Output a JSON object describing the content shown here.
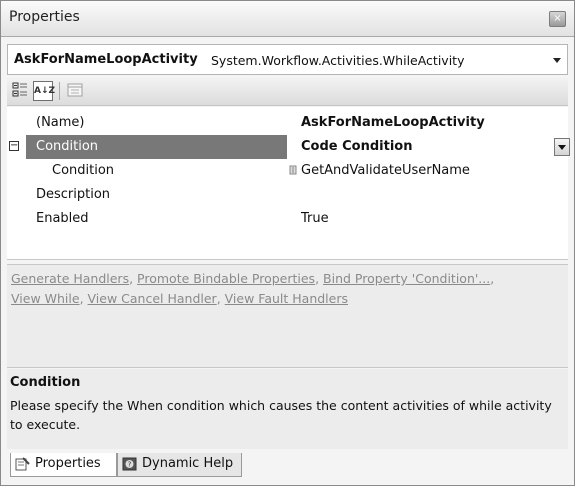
{
  "window": {
    "title": "Properties",
    "close_glyph": "×"
  },
  "selector": {
    "object_name": "AskForNameLoopActivity",
    "object_type": "System.Workflow.Activities.WhileActivity"
  },
  "toolbar": {
    "categorized_icon": "categorized-icon",
    "alphabetical_label": "A↓Z",
    "property_pages_icon": "property-pages-icon"
  },
  "grid": {
    "rows": [
      {
        "name": "(Name)",
        "value": "AskForNameLoopActivity"
      },
      {
        "name": "Condition",
        "value": "Code Condition",
        "expander": "−"
      },
      {
        "name": "Condition",
        "value": "GetAndValidateUserName"
      },
      {
        "name": "Description",
        "value": ""
      },
      {
        "name": "Enabled",
        "value": "True"
      }
    ]
  },
  "commands": {
    "links": [
      "Generate Handlers",
      "Promote Bindable Properties",
      "Bind Property 'Condition'...",
      "View While",
      "View Cancel Handler",
      "View Fault Handlers"
    ]
  },
  "description": {
    "title": "Condition",
    "text": "Please specify the When condition which causes the content activities of while activity to execute."
  },
  "tabs": [
    {
      "label": "Properties",
      "active": true
    },
    {
      "label": "Dynamic Help",
      "active": false
    }
  ]
}
